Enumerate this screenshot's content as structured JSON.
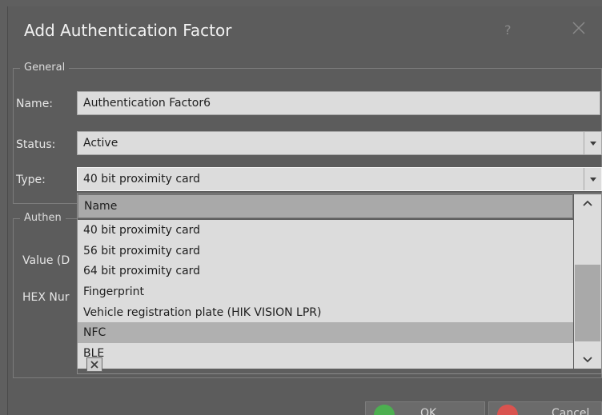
{
  "dialog": {
    "title": "Add Authentication Factor",
    "help_label": "?",
    "close_icon": "close-icon"
  },
  "general": {
    "legend": "General",
    "name_label": "Name:",
    "name_value": "Authentication Factor6",
    "status_label": "Status:",
    "status_value": "Active",
    "type_label": "Type:",
    "type_value": "40 bit proximity card"
  },
  "auth_group": {
    "legend_partial": "Authen",
    "value_label_partial": "Value (D",
    "hex_label_partial": "HEX Nur"
  },
  "dropdown": {
    "header": "Name",
    "items": [
      "40 bit proximity card",
      "56 bit proximity card",
      "64 bit proximity card",
      "Fingerprint",
      "Vehicle registration plate (HIK VISION LPR)",
      "NFC",
      "BLE"
    ],
    "selected_index": 5,
    "clear_icon": "close-icon"
  },
  "buttons": {
    "ok_label": "OK",
    "cancel_label": "Cancel"
  },
  "colors": {
    "window_bg": "#5c5c5c",
    "field_bg": "#dcdcdc",
    "selected_row": "#b0b0b0",
    "ok_green": "#4caf50",
    "cancel_red": "#d9534f"
  }
}
